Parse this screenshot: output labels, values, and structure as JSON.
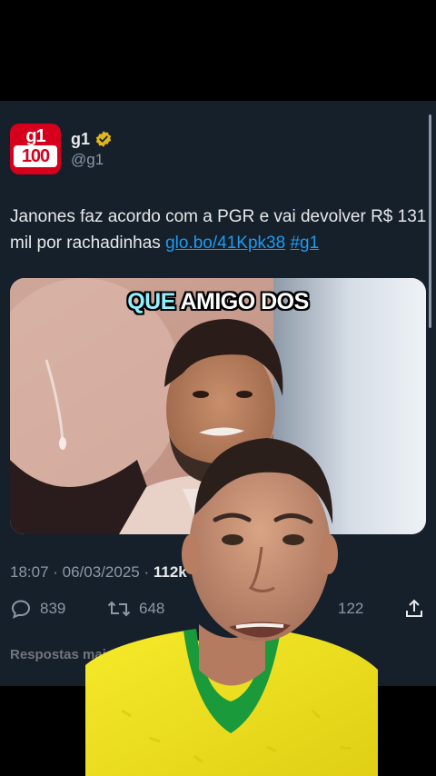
{
  "tweet": {
    "author": {
      "name": "g1",
      "handle": "@g1",
      "avatar_top": "g1",
      "avatar_bottom": "100"
    },
    "text": "Janones faz acordo com a PGR e vai devolver R$ 131 mil por rachadinhas",
    "link_text": "glo.bo/41Kpk38",
    "hashtag": "#g1",
    "timestamp": "18:07 · 06/03/2025 · ",
    "views": "112k",
    "stats": {
      "replies": "839",
      "reposts": "648",
      "bookmarks": "122"
    },
    "replies_label": "Respostas mais"
  },
  "overlay_caption": {
    "word1": "QUE",
    "word2": "AMIGO DOS"
  },
  "colors": {
    "background": "#16202b",
    "link": "#1d9bf0",
    "brand_red": "#d6001c",
    "verified_gold": "#e2b719",
    "caption_cyan": "#8ff0ff",
    "shirt_yellow": "#f2e221",
    "collar_green": "#1a9a3a"
  },
  "icons": [
    "verified-badge-icon",
    "reply-icon",
    "repost-icon",
    "share-icon"
  ]
}
